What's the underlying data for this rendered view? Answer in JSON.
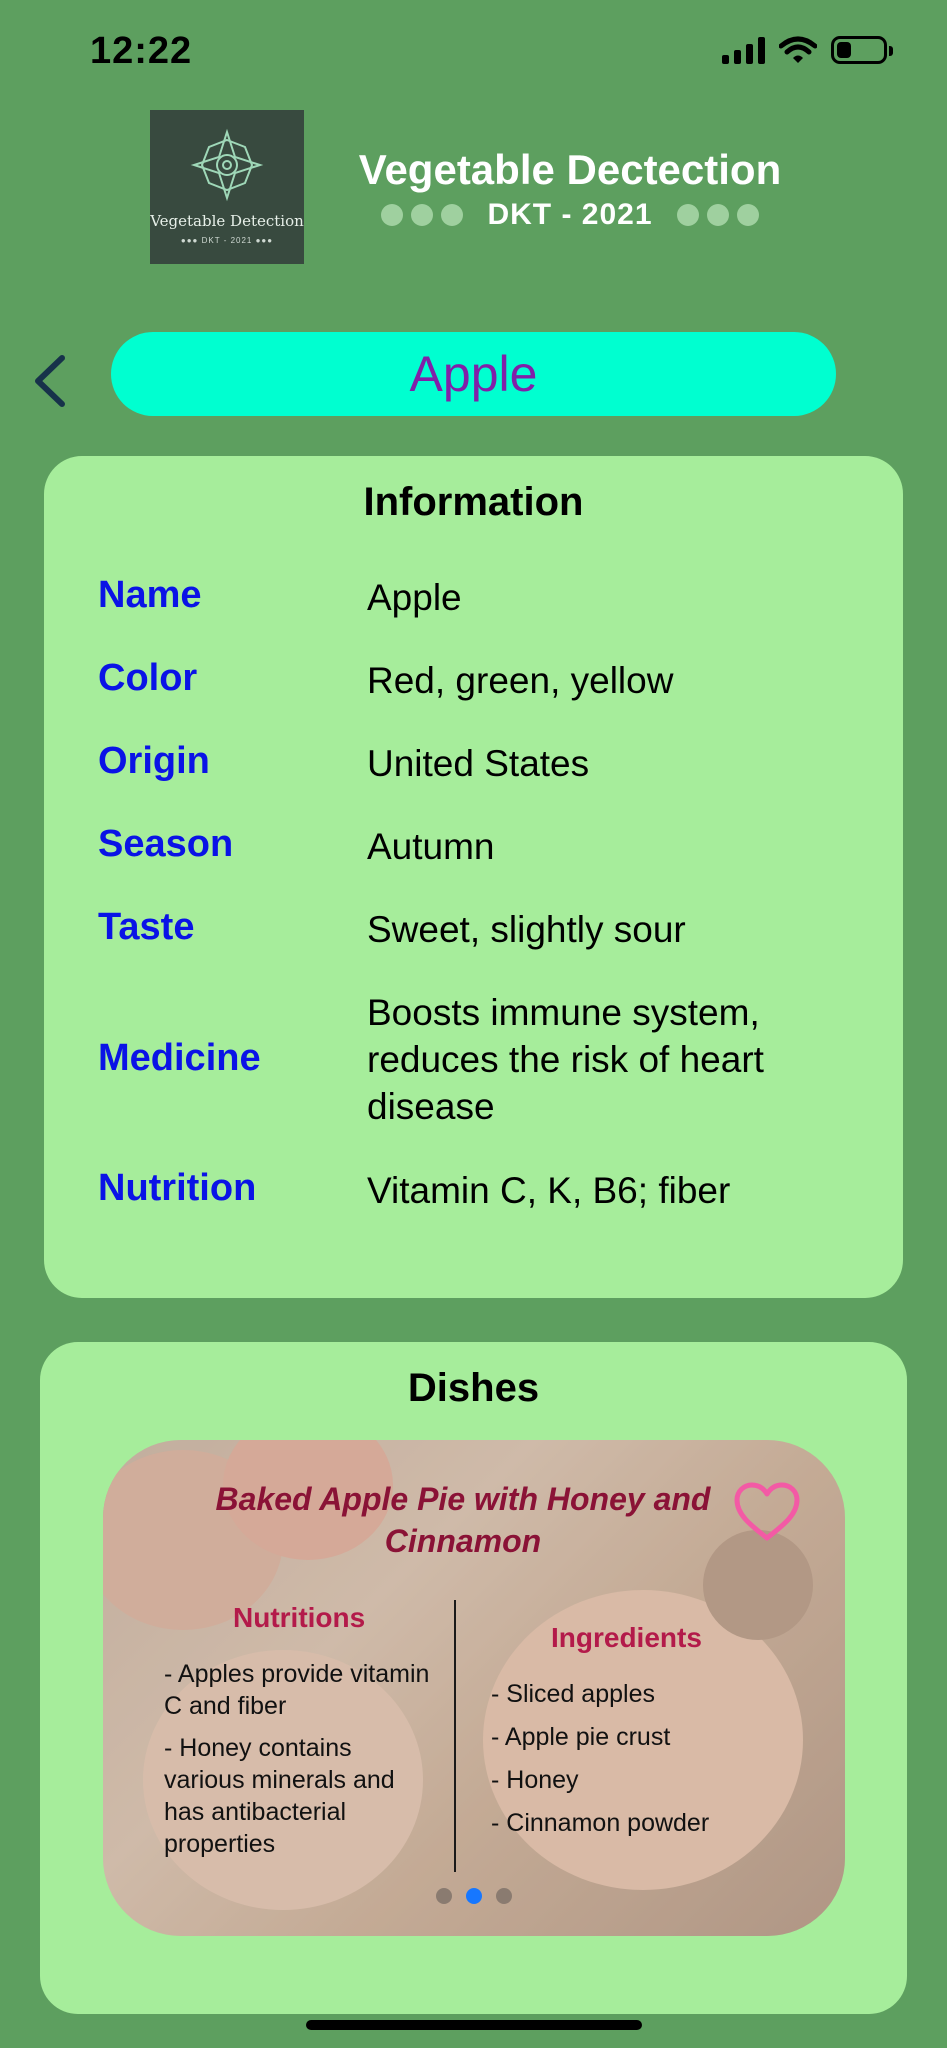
{
  "status_bar": {
    "time": "12:22"
  },
  "header": {
    "logo": {
      "title": "Vegetable Detection",
      "subtitle": "●●● DKT - 2021 ●●●"
    },
    "app_title": "Vegetable Dectection",
    "app_subtitle": "DKT - 2021"
  },
  "vegetable_name": "Apple",
  "information": {
    "title": "Information",
    "rows": [
      {
        "label": "Name",
        "value": "Apple"
      },
      {
        "label": "Color",
        "value": "Red, green, yellow"
      },
      {
        "label": "Origin",
        "value": "United States"
      },
      {
        "label": "Season",
        "value": "Autumn"
      },
      {
        "label": "Taste",
        "value": "Sweet, slightly sour"
      },
      {
        "label": "Medicine",
        "value": "Boosts immune system, reduces the risk of heart disease"
      },
      {
        "label": "Nutrition",
        "value": "Vitamin C, K, B6; fiber"
      }
    ]
  },
  "dishes": {
    "title": "Dishes",
    "current_dish": {
      "name": "Baked Apple Pie with Honey and Cinnamon",
      "nutritions_heading": "Nutritions",
      "nutritions": [
        "- Apples provide vitamin C and fiber",
        "- Honey contains various minerals and has antibacterial properties"
      ],
      "ingredients_heading": "Ingredients",
      "ingredients": [
        "- Sliced apples",
        "- Apple pie crust",
        "- Honey",
        "- Cinnamon powder"
      ]
    },
    "pager": {
      "total": 3,
      "active": 2
    }
  },
  "colors": {
    "background": "#5d9f5f",
    "card": "#a6ed9b",
    "pill": "#00ffd0",
    "pill_text": "#8020a8",
    "label_text": "#0a13e6",
    "dish_title": "#8a1236",
    "section_heading": "#b31a4a",
    "heart": "#f35aa5"
  },
  "icons": {
    "back": "chevron-left-icon",
    "favorite": "heart-outline-icon"
  }
}
